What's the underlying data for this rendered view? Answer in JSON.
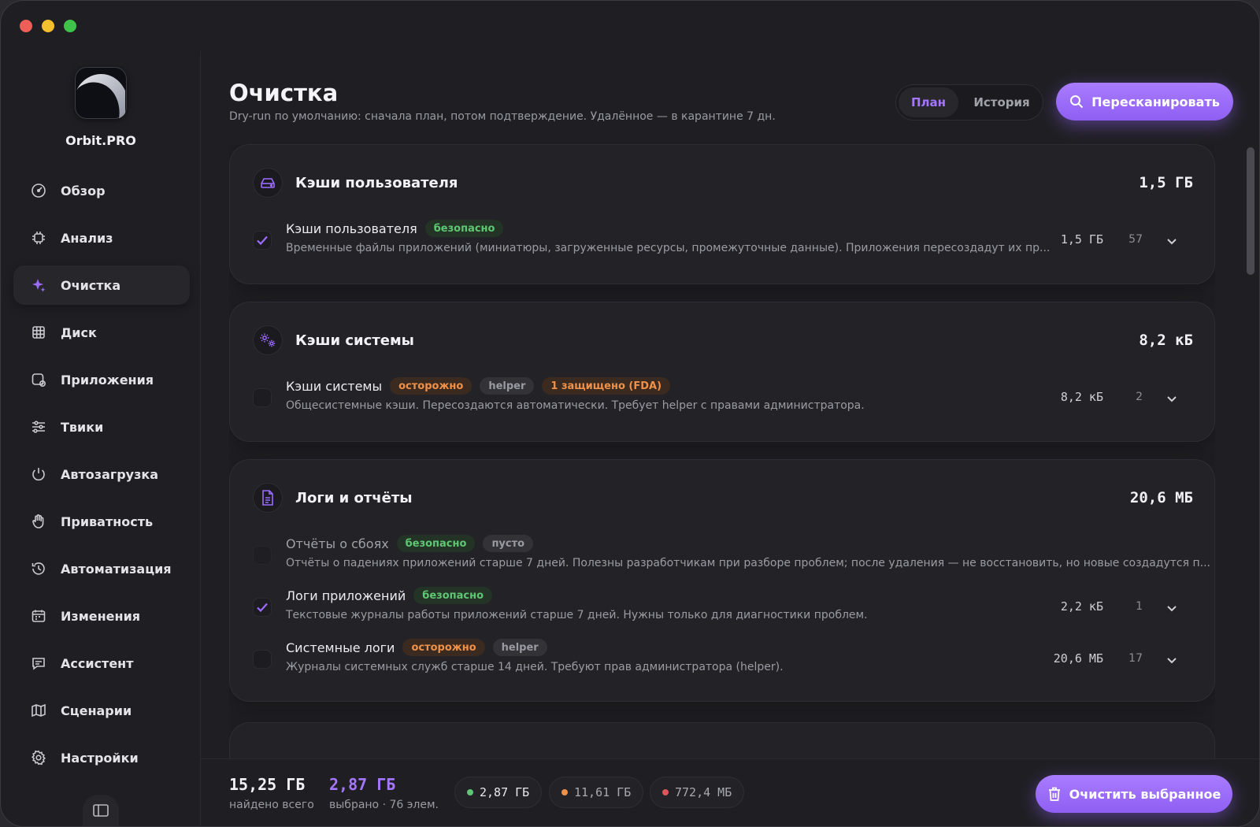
{
  "app": {
    "name": "Orbit.PRO"
  },
  "colors": {
    "accent": "#9b6cff",
    "safe": "#5fc773",
    "warn": "#f0914a",
    "danger": "#e0555a"
  },
  "sidebar": {
    "items": [
      {
        "label": "Обзор",
        "icon": "gauge-icon"
      },
      {
        "label": "Анализ",
        "icon": "chip-icon"
      },
      {
        "label": "Очистка",
        "icon": "sparkle-icon",
        "active": true
      },
      {
        "label": "Диск",
        "icon": "grid-icon"
      },
      {
        "label": "Приложения",
        "icon": "app-icon"
      },
      {
        "label": "Твики",
        "icon": "sliders-icon"
      },
      {
        "label": "Автозагрузка",
        "icon": "power-icon"
      },
      {
        "label": "Приватность",
        "icon": "hand-icon"
      },
      {
        "label": "Автоматизация",
        "icon": "history-icon"
      },
      {
        "label": "Изменения",
        "icon": "calendar-icon"
      },
      {
        "label": "Ассистент",
        "icon": "chat-icon"
      },
      {
        "label": "Сценарии",
        "icon": "map-icon"
      },
      {
        "label": "Настройки",
        "icon": "gear-icon"
      }
    ]
  },
  "header": {
    "title": "Очистка",
    "subtitle": "Dry-run по умолчанию: сначала план, потом подтверждение. Удалённое — в карантине 7 дн.",
    "tabs": [
      "План",
      "История"
    ],
    "rescan_label": "Пересканировать"
  },
  "cards": [
    {
      "title": "Кэши пользователя",
      "size": "1,5 ГБ",
      "rows": [
        {
          "name": "Кэши пользователя",
          "badges": [
            {
              "text": "безопасно",
              "kind": "safe"
            }
          ],
          "desc": "Временные файлы приложений (миниатюры, загруженные ресурсы, промежуточные данные). Приложения пересоздадут их пр...",
          "size": "1,5 ГБ",
          "count": "57",
          "checked": true
        }
      ]
    },
    {
      "title": "Кэши системы",
      "size": "8,2 кБ",
      "rows": [
        {
          "name": "Кэши системы",
          "badges": [
            {
              "text": "осторожно",
              "kind": "warn"
            },
            {
              "text": "helper",
              "kind": "gray"
            },
            {
              "text": "1 защищено (FDA)",
              "kind": "warn"
            }
          ],
          "desc": "Общесистемные кэши. Пересоздаются автоматически. Требует helper с правами администратора.",
          "size": "8,2 кБ",
          "count": "2",
          "checked": false
        }
      ]
    },
    {
      "title": "Логи и отчёты",
      "size": "20,6 МБ",
      "rows": [
        {
          "name": "Отчёты о сбоях",
          "badges": [
            {
              "text": "безопасно",
              "kind": "safe"
            },
            {
              "text": "пусто",
              "kind": "gray"
            }
          ],
          "desc": "Отчёты о падениях приложений старше 7 дней. Полезны разработчикам при разборе проблем; после удаления — не восстановить, но новые создадутся п...",
          "size": "",
          "count": "",
          "checked": false
        },
        {
          "name": "Логи приложений",
          "badges": [
            {
              "text": "безопасно",
              "kind": "safe"
            }
          ],
          "desc": "Текстовые журналы работы приложений старше 7 дней. Нужны только для диагностики проблем.",
          "size": "2,2 кБ",
          "count": "1",
          "checked": true
        },
        {
          "name": "Системные логи",
          "badges": [
            {
              "text": "осторожно",
              "kind": "warn"
            },
            {
              "text": "helper",
              "kind": "gray"
            }
          ],
          "desc": "Журналы системных служб старше 14 дней. Требуют прав администратора (helper).",
          "size": "20,6 МБ",
          "count": "17",
          "checked": false
        }
      ]
    }
  ],
  "footer": {
    "total_value": "15,25 ГБ",
    "total_label": "найдено всего",
    "selected_value": "2,87 ГБ",
    "selected_label": "выбрано · 76 элем.",
    "pills": [
      {
        "value": "2,87 ГБ",
        "color": "#5fc773"
      },
      {
        "value": "11,61 ГБ",
        "color": "#f0914a"
      },
      {
        "value": "772,4 МБ",
        "color": "#e0555a"
      }
    ],
    "clean_label": "Очистить выбранное"
  }
}
